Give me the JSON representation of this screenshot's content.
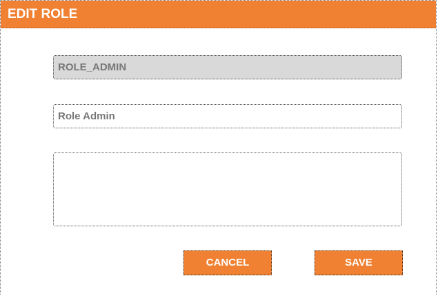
{
  "dialog": {
    "title": "EDIT ROLE"
  },
  "form": {
    "role_code": "ROLE_ADMIN",
    "role_name": "Role Admin",
    "description": ""
  },
  "actions": {
    "cancel_label": "CANCEL",
    "save_label": "SAVE"
  },
  "colors": {
    "accent": "#f08132",
    "disabled_field": "#d9d9d9",
    "field_text": "#777777"
  }
}
